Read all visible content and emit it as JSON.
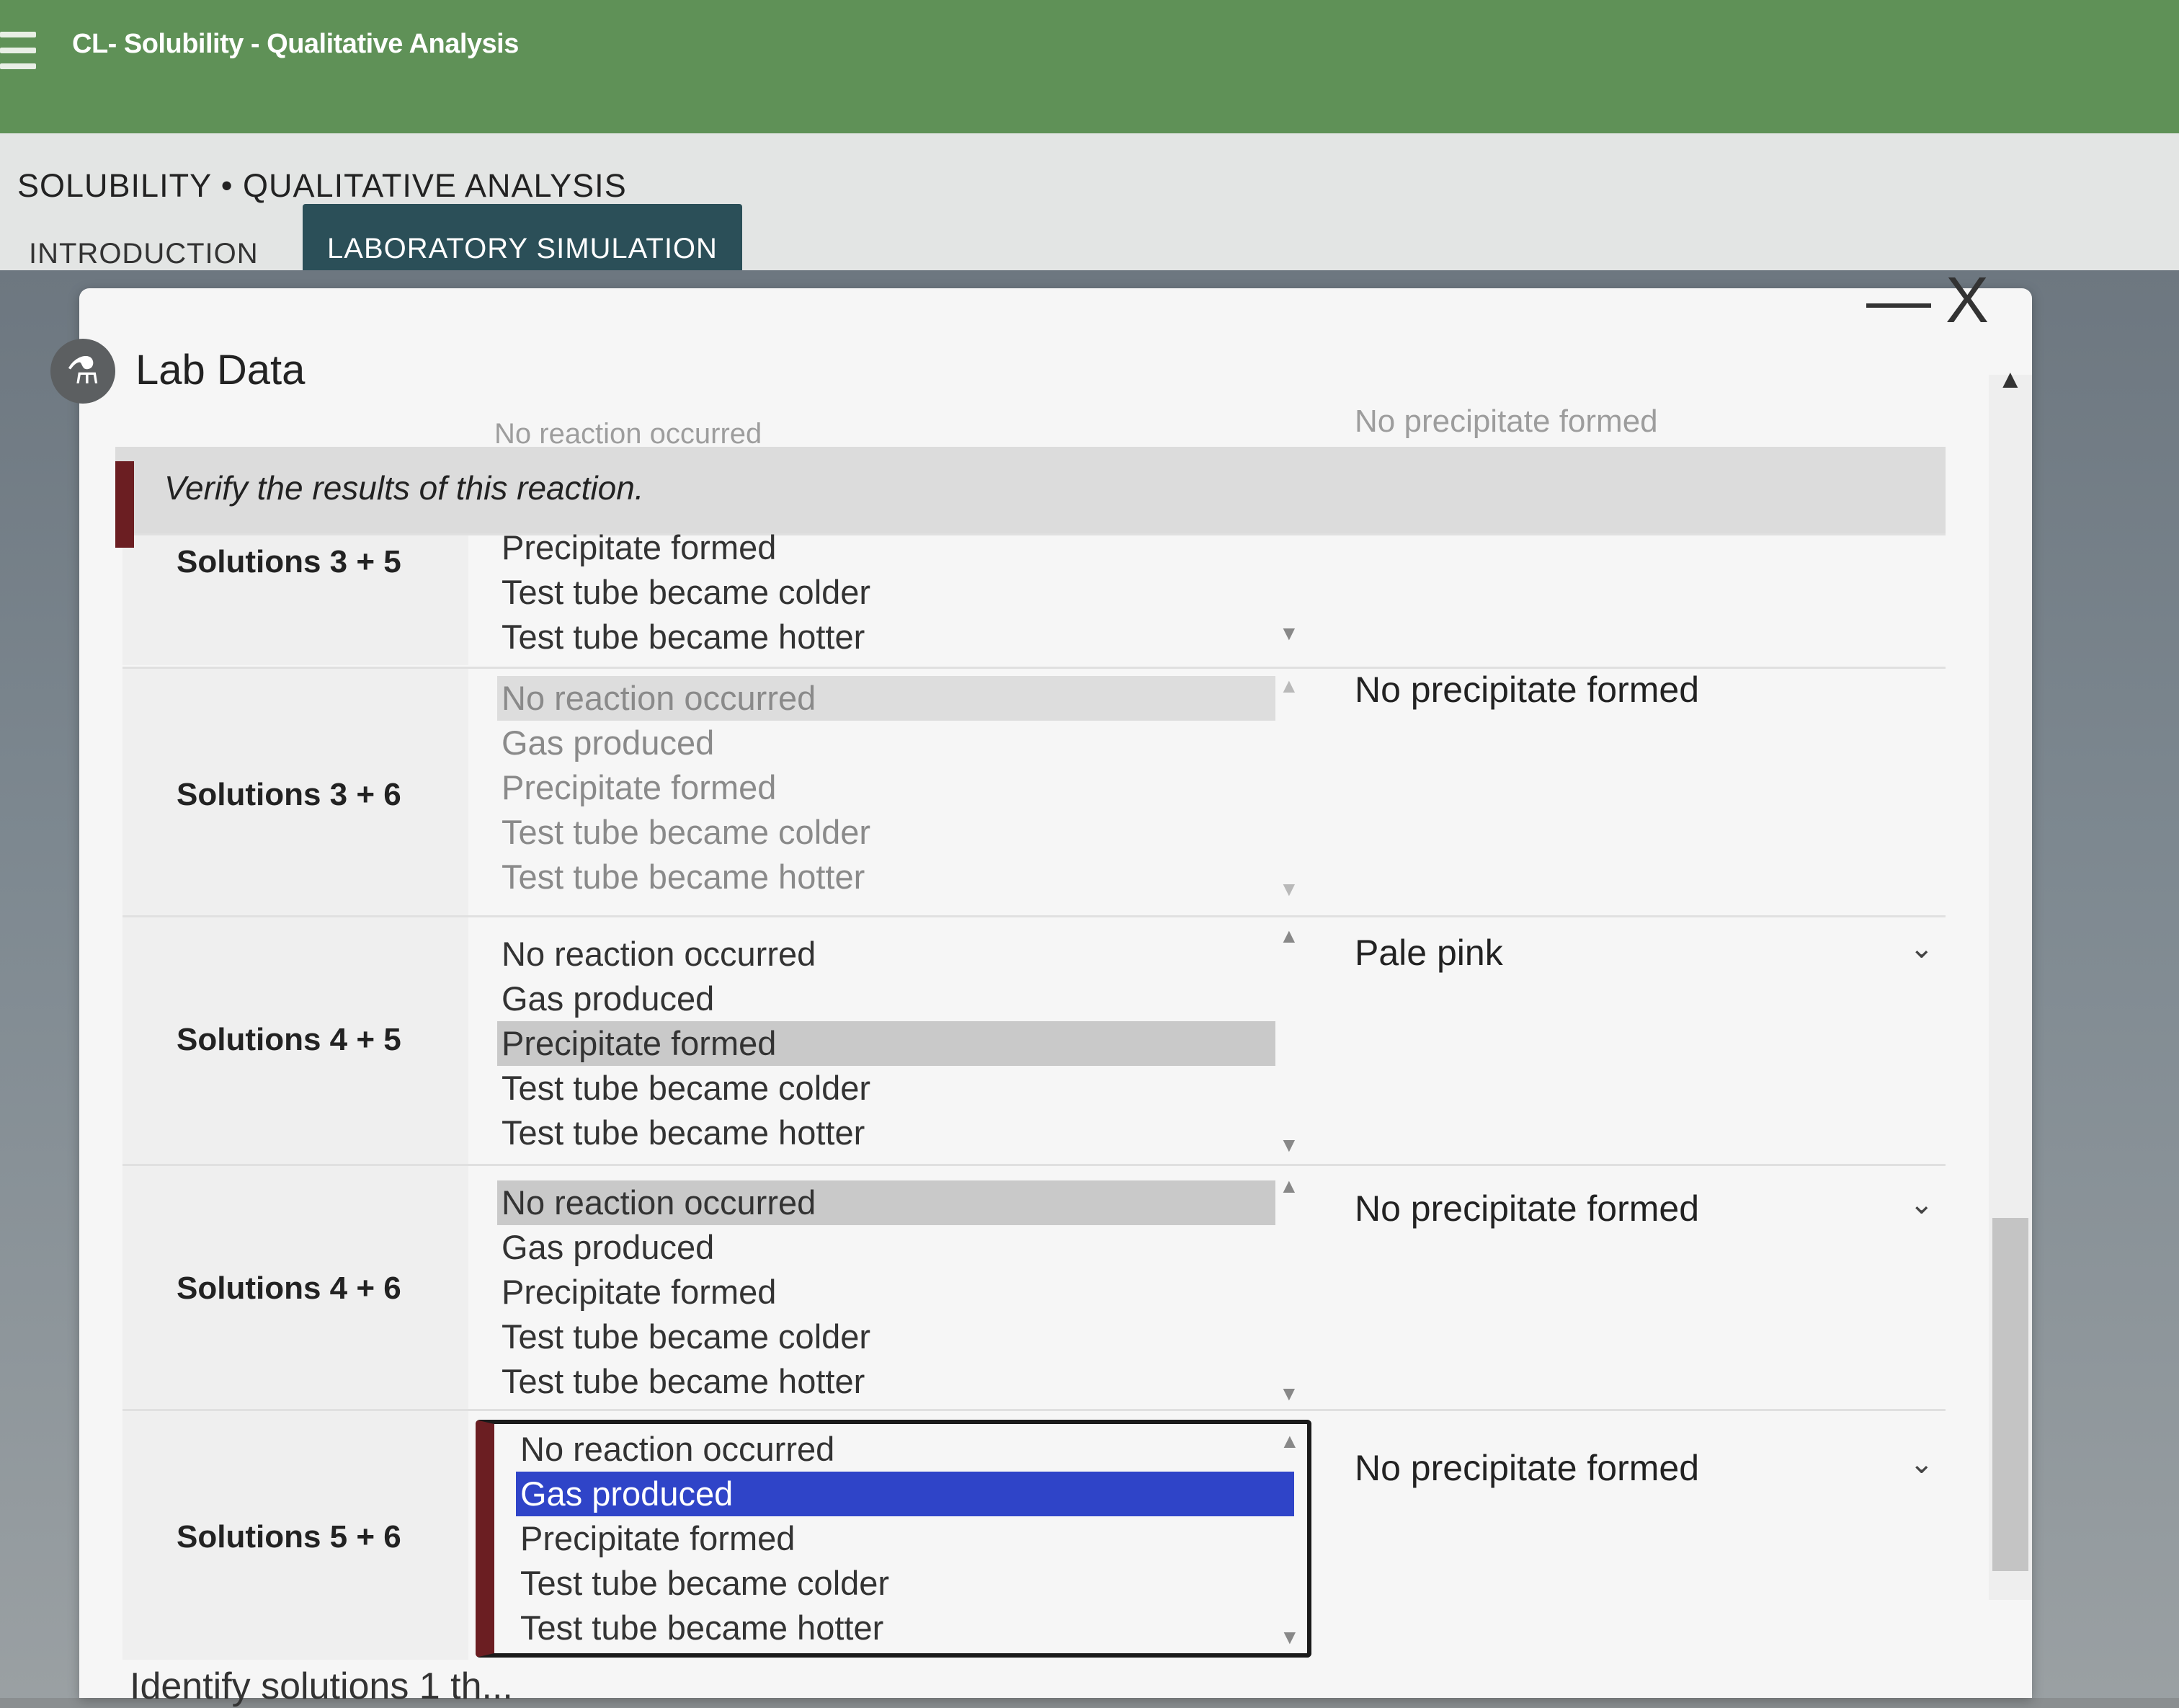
{
  "app": {
    "title": "CL- Solubility - Qualitative Analysis"
  },
  "header": {
    "breadcrumb": "SOLUBILITY • QUALITATIVE ANALYSIS",
    "tabs": [
      {
        "label": "INTRODUCTION"
      },
      {
        "label": "LABORATORY SIMULATION"
      }
    ]
  },
  "panel": {
    "title": "Lab Data",
    "minimize": "—",
    "close": "X",
    "partial_top_option": "No reaction occurred",
    "partial_top_result": "No precipitate formed",
    "verify": "Verify the results of this reaction."
  },
  "rows": [
    {
      "label": "Solutions 3 + 5",
      "options": [
        "Precipitate formed",
        "Test tube became colder",
        "Test tube became hotter"
      ],
      "result": ""
    },
    {
      "label": "Solutions 3 + 6",
      "options": [
        "No reaction occurred",
        "Gas produced",
        "Precipitate formed",
        "Test tube became colder",
        "Test tube became hotter"
      ],
      "result": "No precipitate formed"
    },
    {
      "label": "Solutions 4 + 5",
      "options": [
        "No reaction occurred",
        "Gas produced",
        "Precipitate formed",
        "Test tube became colder",
        "Test tube became hotter"
      ],
      "result": "Pale pink"
    },
    {
      "label": "Solutions 4 + 6",
      "options": [
        "No reaction occurred",
        "Gas produced",
        "Precipitate formed",
        "Test tube became colder",
        "Test tube became hotter"
      ],
      "result": "No precipitate formed"
    },
    {
      "label": "Solutions 5 + 6",
      "options": [
        "No reaction occurred",
        "Gas produced",
        "Precipitate formed",
        "Test tube became colder",
        "Test tube became hotter"
      ],
      "result": "No precipitate formed"
    }
  ],
  "footer": {
    "text": "Identify solutions 1 th..."
  }
}
